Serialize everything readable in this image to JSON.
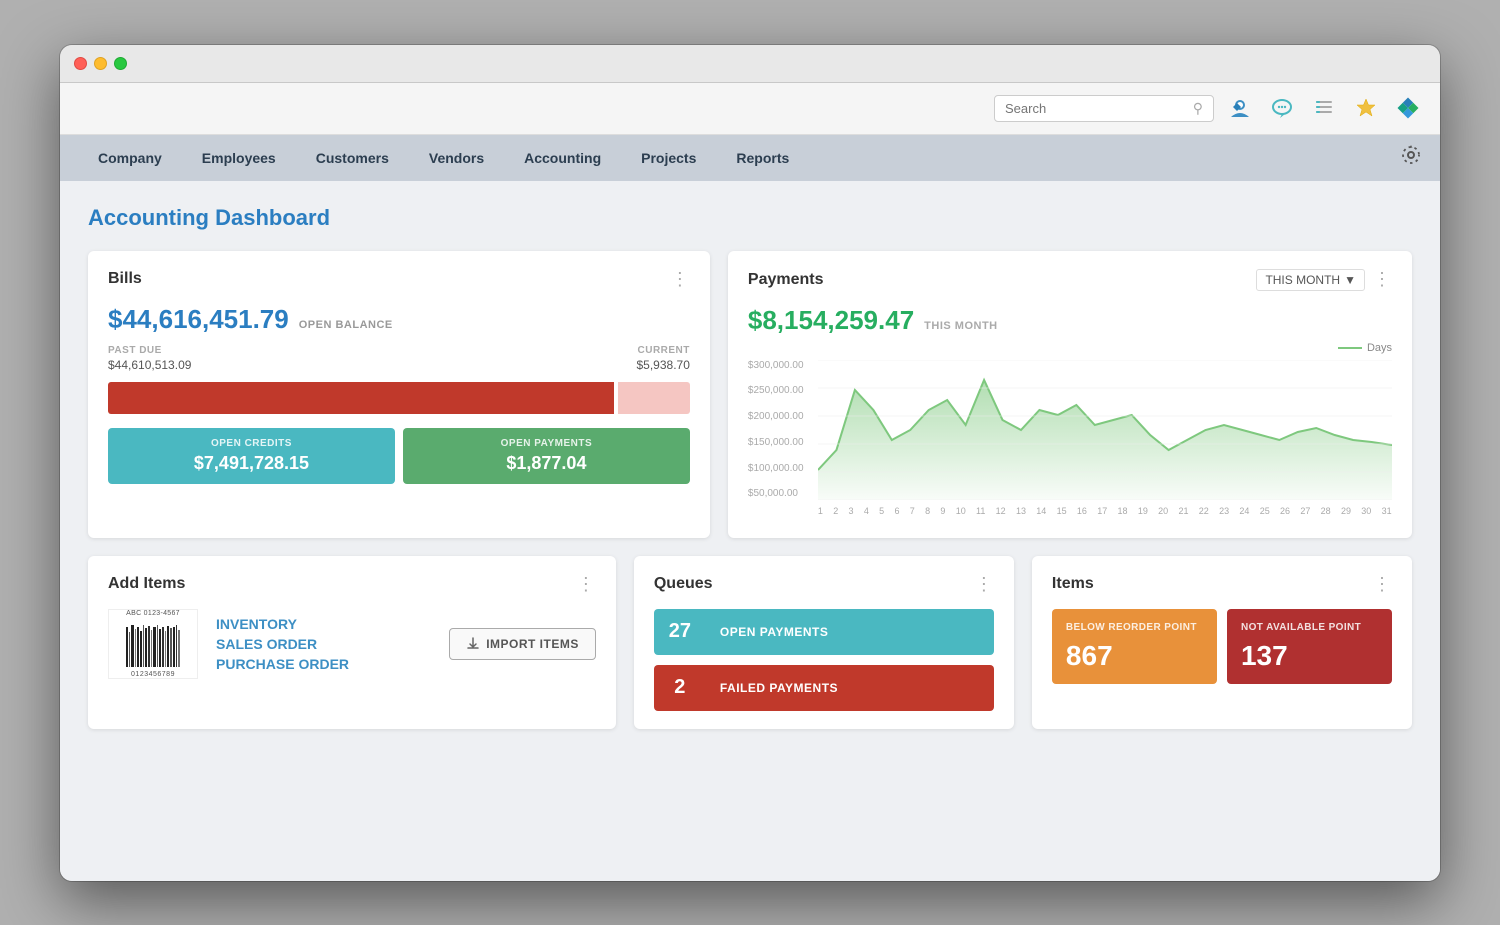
{
  "window": {
    "title": "Accounting Dashboard"
  },
  "topbar": {
    "search_placeholder": "Search"
  },
  "nav": {
    "items": [
      {
        "label": "Company"
      },
      {
        "label": "Employees"
      },
      {
        "label": "Customers"
      },
      {
        "label": "Vendors"
      },
      {
        "label": "Accounting"
      },
      {
        "label": "Projects"
      },
      {
        "label": "Reports"
      }
    ]
  },
  "page": {
    "title": "Accounting Dashboard"
  },
  "bills": {
    "title": "Bills",
    "open_balance_amount": "$44,616,451.79",
    "open_balance_label": "OPEN BALANCE",
    "past_due_label": "PAST DUE",
    "past_due_value": "$44,610,513.09",
    "current_label": "CURRENT",
    "current_value": "$5,938.70",
    "open_credits_label": "OPEN CREDITS",
    "open_credits_value": "$7,491,728.15",
    "open_payments_label": "OPEN PAYMENTS",
    "open_payments_value": "$1,877.04"
  },
  "payments": {
    "title": "Payments",
    "filter_label": "THIS MONTH",
    "amount": "$8,154,259.47",
    "period_label": "THIS MONTH",
    "legend_label": "Days",
    "y_labels": [
      "$300,000.00",
      "$250,000.00",
      "$200,000.00",
      "$150,000.00",
      "$100,000.00",
      "$50,000.00"
    ],
    "x_labels": [
      "1",
      "2",
      "3",
      "4",
      "5",
      "6",
      "7",
      "8",
      "9",
      "10",
      "11",
      "12",
      "13",
      "14",
      "15",
      "16",
      "17",
      "18",
      "19",
      "20",
      "21",
      "22",
      "23",
      "24",
      "25",
      "26",
      "27",
      "28",
      "29",
      "30",
      "31"
    ]
  },
  "add_items": {
    "title": "Add Items",
    "barcode_number": "ABC 0123-4567",
    "barcode_sub": "0123456789",
    "links": [
      "INVENTORY",
      "SALES ORDER",
      "PURCHASE ORDER"
    ],
    "import_button": "IMPORT ITEMS"
  },
  "queues": {
    "title": "Queues",
    "items": [
      {
        "count": "27",
        "label": "OPEN PAYMENTS",
        "color": "teal"
      },
      {
        "count": "2",
        "label": "FAILED PAYMENTS",
        "color": "red"
      }
    ]
  },
  "items": {
    "title": "Items",
    "stats": [
      {
        "label": "BELOW REORDER POINT",
        "value": "867",
        "color": "orange"
      },
      {
        "label": "NOT AVAILABLE POINT",
        "value": "137",
        "color": "crimson"
      }
    ]
  }
}
